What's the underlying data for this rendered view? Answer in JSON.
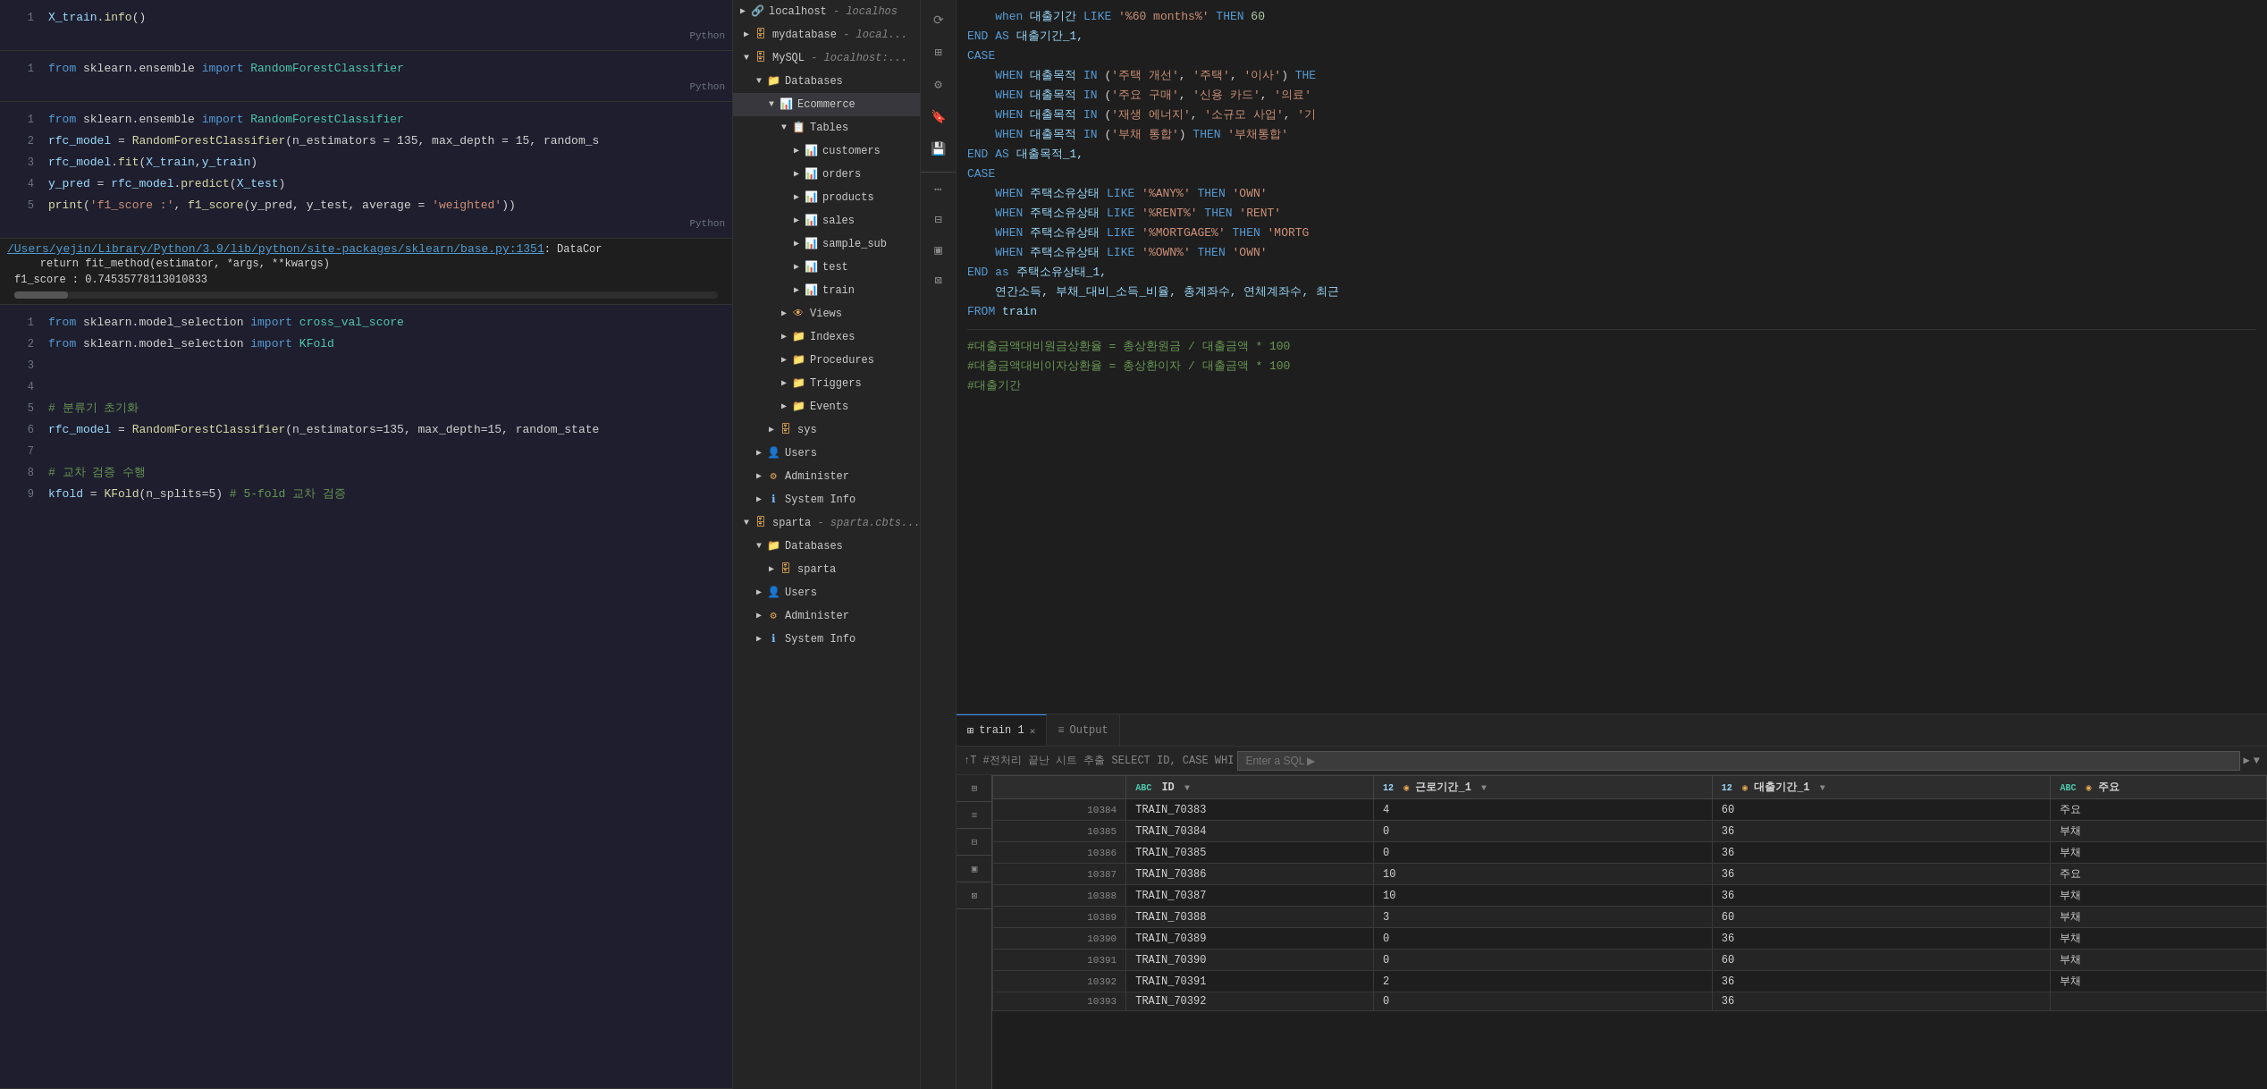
{
  "leftPanel": {
    "blocks": [
      {
        "id": "block1",
        "lines": [
          {
            "num": 1,
            "tokens": [
              {
                "t": "X_train",
                "c": "var"
              },
              {
                "t": ".",
                "c": "op"
              },
              {
                "t": "info",
                "c": "fn"
              },
              {
                "t": "()",
                "c": "op"
              }
            ]
          }
        ],
        "lang": "Python"
      },
      {
        "id": "block2",
        "lines": [
          {
            "num": 1,
            "tokens": [
              {
                "t": "from ",
                "c": "kw"
              },
              {
                "t": "sklearn.ensemble ",
                "c": "ident"
              },
              {
                "t": "import ",
                "c": "kw"
              },
              {
                "t": "RandomForestClassifier",
                "c": "cls"
              }
            ]
          }
        ],
        "lang": "Python"
      },
      {
        "id": "block3",
        "lines": [
          {
            "num": 1,
            "tokens": [
              {
                "t": "from ",
                "c": "kw"
              },
              {
                "t": "sklearn.ensemble ",
                "c": "ident"
              },
              {
                "t": "import ",
                "c": "kw"
              },
              {
                "t": "RandomForestClassifier",
                "c": "cls"
              }
            ]
          },
          {
            "num": 2,
            "tokens": [
              {
                "t": "rfc_model ",
                "c": "var"
              },
              {
                "t": "= ",
                "c": "op"
              },
              {
                "t": "RandomForestClassifier",
                "c": "fn"
              },
              {
                "t": "(n_estimators = 135, max_depth = 15, random_s",
                "c": "ident"
              }
            ]
          },
          {
            "num": 3,
            "tokens": [
              {
                "t": "rfc_model",
                "c": "var"
              },
              {
                "t": ".",
                "c": "op"
              },
              {
                "t": "fit",
                "c": "fn"
              },
              {
                "t": "(",
                "c": "op"
              },
              {
                "t": "X_train",
                "c": "var"
              },
              {
                "t": ",",
                "c": "op"
              },
              {
                "t": "y_train",
                "c": "var"
              },
              {
                "t": ")",
                "c": "op"
              }
            ]
          },
          {
            "num": 4,
            "tokens": [
              {
                "t": "y_pred ",
                "c": "var"
              },
              {
                "t": "= ",
                "c": "op"
              },
              {
                "t": "rfc_model",
                "c": "var"
              },
              {
                "t": ".",
                "c": "op"
              },
              {
                "t": "predict",
                "c": "fn"
              },
              {
                "t": "(",
                "c": "op"
              },
              {
                "t": "X_test",
                "c": "var"
              },
              {
                "t": ")",
                "c": "op"
              }
            ]
          },
          {
            "num": 5,
            "tokens": [
              {
                "t": "print",
                "c": "fn"
              },
              {
                "t": "(",
                "c": "op"
              },
              {
                "t": "'f1_score :'",
                "c": "str"
              },
              {
                "t": ", ",
                "c": "op"
              },
              {
                "t": "f1_score",
                "c": "fn"
              },
              {
                "t": "(y_pred, y_test, average = ",
                "c": "ident"
              },
              {
                "t": "'weighted'",
                "c": "str"
              },
              {
                "t": "))",
                "c": "op"
              }
            ]
          }
        ],
        "lang": "Python"
      }
    ],
    "errorLine": "/Users/yejin/Library/Python/3.9/lib/python/site-packages/sklearn/base.py:1351",
    "errorSuffix": ": DataCor",
    "returnLine": "    return fit_method(estimator, *args, **kwargs)",
    "f1Line": "f1_score : 0.74535778113010833",
    "block4": {
      "lines": [
        {
          "num": 1,
          "tokens": [
            {
              "t": "from ",
              "c": "kw"
            },
            {
              "t": "sklearn.model_selection ",
              "c": "ident"
            },
            {
              "t": "import ",
              "c": "kw"
            },
            {
              "t": "cross_val_score",
              "c": "cls"
            }
          ]
        },
        {
          "num": 2,
          "tokens": [
            {
              "t": "from ",
              "c": "kw"
            },
            {
              "t": "sklearn.model_selection ",
              "c": "ident"
            },
            {
              "t": "import ",
              "c": "kw"
            },
            {
              "t": "KFold",
              "c": "cls"
            }
          ]
        },
        {
          "num": 3,
          "tokens": []
        },
        {
          "num": 4,
          "tokens": []
        },
        {
          "num": 5,
          "tokens": [
            {
              "t": "# 분류기 초기화",
              "c": "cm"
            }
          ]
        },
        {
          "num": 6,
          "tokens": [
            {
              "t": "rfc_model ",
              "c": "var"
            },
            {
              "t": "= ",
              "c": "op"
            },
            {
              "t": "RandomForestClassifier",
              "c": "fn"
            },
            {
              "t": "(n_estimators=135, max_depth=15, random_state",
              "c": "ident"
            }
          ]
        },
        {
          "num": 7,
          "tokens": []
        },
        {
          "num": 8,
          "tokens": [
            {
              "t": "# 교차 검증 수행",
              "c": "cm"
            }
          ]
        },
        {
          "num": 9,
          "tokens": [
            {
              "t": "kfold ",
              "c": "var"
            },
            {
              "t": "= ",
              "c": "op"
            },
            {
              "t": "KFold",
              "c": "fn"
            },
            {
              "t": "(n_splits=5)  ",
              "c": "ident"
            },
            {
              "t": "# 5-fold 교차 검증",
              "c": "cm"
            }
          ]
        }
      ],
      "lang": "Python"
    }
  },
  "tree": {
    "items": [
      {
        "indent": 0,
        "arrow": "▶",
        "icon": "🔗",
        "label": "localhost",
        "italic": " - localhos",
        "id": "localhost"
      },
      {
        "indent": 1,
        "arrow": "▶",
        "icon": "🗄",
        "label": "mydatabase",
        "italic": " - local...",
        "id": "mydatabase"
      },
      {
        "indent": 1,
        "arrow": "▼",
        "icon": "🗄",
        "label": "MySQL",
        "italic": " - localhost:...",
        "id": "mysql"
      },
      {
        "indent": 2,
        "arrow": "▼",
        "icon": "📁",
        "label": "Databases",
        "italic": "",
        "id": "databases"
      },
      {
        "indent": 3,
        "arrow": "▼",
        "icon": "🗄",
        "label": "Ecommerce",
        "italic": "",
        "id": "ecommerce",
        "highlight": true
      },
      {
        "indent": 4,
        "arrow": "▼",
        "icon": "📋",
        "label": "Tables",
        "italic": "",
        "id": "tables"
      },
      {
        "indent": 5,
        "arrow": "▶",
        "icon": "📊",
        "label": "customers",
        "italic": "",
        "id": "customers"
      },
      {
        "indent": 5,
        "arrow": "▶",
        "icon": "📊",
        "label": "orders",
        "italic": "",
        "id": "orders"
      },
      {
        "indent": 5,
        "arrow": "▶",
        "icon": "📊",
        "label": "products",
        "italic": "",
        "id": "products"
      },
      {
        "indent": 5,
        "arrow": "▶",
        "icon": "📊",
        "label": "sales",
        "italic": "",
        "id": "sales"
      },
      {
        "indent": 5,
        "arrow": "▶",
        "icon": "📊",
        "label": "sample_sub",
        "italic": "",
        "id": "sample_sub"
      },
      {
        "indent": 5,
        "arrow": "▶",
        "icon": "📊",
        "label": "test",
        "italic": "",
        "id": "test"
      },
      {
        "indent": 5,
        "arrow": "▶",
        "icon": "📊",
        "label": "train",
        "italic": "",
        "id": "train"
      },
      {
        "indent": 4,
        "arrow": "▶",
        "icon": "👁",
        "label": "Views",
        "italic": "",
        "id": "views"
      },
      {
        "indent": 4,
        "arrow": "▶",
        "icon": "📁",
        "label": "Indexes",
        "italic": "",
        "id": "indexes"
      },
      {
        "indent": 4,
        "arrow": "▶",
        "icon": "📁",
        "label": "Procedures",
        "italic": "",
        "id": "procedures"
      },
      {
        "indent": 4,
        "arrow": "▶",
        "icon": "📁",
        "label": "Triggers",
        "italic": "",
        "id": "triggers"
      },
      {
        "indent": 4,
        "arrow": "▶",
        "icon": "📁",
        "label": "Events",
        "italic": "",
        "id": "events"
      },
      {
        "indent": 3,
        "arrow": "▶",
        "icon": "🗄",
        "label": "sys",
        "italic": "",
        "id": "sys"
      },
      {
        "indent": 2,
        "arrow": "▶",
        "icon": "👤",
        "label": "Users",
        "italic": "",
        "id": "mysql-users"
      },
      {
        "indent": 2,
        "arrow": "▶",
        "icon": "⚙",
        "label": "Administer",
        "italic": "",
        "id": "mysql-administer"
      },
      {
        "indent": 2,
        "arrow": "▶",
        "icon": "ℹ",
        "label": "System Info",
        "italic": "",
        "id": "mysql-sysinfo"
      },
      {
        "indent": 1,
        "arrow": "▼",
        "icon": "🗄",
        "label": "sparta",
        "italic": " - sparta.cbts...",
        "id": "sparta"
      },
      {
        "indent": 2,
        "arrow": "▼",
        "icon": "📁",
        "label": "Databases",
        "italic": "",
        "id": "sparta-databases"
      },
      {
        "indent": 3,
        "arrow": "▶",
        "icon": "🗄",
        "label": "sparta",
        "italic": "",
        "id": "sparta-db"
      },
      {
        "indent": 2,
        "arrow": "▶",
        "icon": "👤",
        "label": "Users",
        "italic": "",
        "id": "sparta-users"
      },
      {
        "indent": 2,
        "arrow": "▶",
        "icon": "⚙",
        "label": "Administer",
        "italic": "",
        "id": "sparta-admin"
      },
      {
        "indent": 2,
        "arrow": "▶",
        "icon": "ℹ",
        "label": "System Info",
        "italic": "",
        "id": "sparta-sysinfo"
      }
    ]
  },
  "iconStrip": {
    "icons": [
      {
        "id": "refresh-icon",
        "glyph": "⟳"
      },
      {
        "id": "grid-icon",
        "glyph": "⊞"
      },
      {
        "id": "settings-icon",
        "glyph": "⚙"
      },
      {
        "id": "bookmark-icon",
        "glyph": "🔖"
      },
      {
        "id": "save-icon",
        "glyph": "💾"
      }
    ]
  },
  "sqlEditor": {
    "lines": [
      "    when 대출기간 LIKE '%60 months%' THEN 60",
      "END AS 대출기간_1,",
      "CASE",
      "    WHEN 대출목적 IN ('주택 개선', '주택', '이사') THE",
      "    WHEN 대출목적 IN ('주요 구매', '신용 카드', '의료'",
      "    WHEN 대출목적 IN ('재생 에너지', '소규모 사업', '기",
      "    WHEN 대출목적 IN ('부채 통합') THEN '부채통합'",
      "END AS 대출목적_1,",
      "CASE",
      "    WHEN 주택소유상태 LIKE '%ANY%' THEN 'OWN'",
      "    WHEN 주택소유상태 LIKE '%RENT%' THEN 'RENT'",
      "    WHEN 주택소유상태 LIKE '%MORTGAGE%' THEN 'MORTG",
      "    WHEN 주택소유상태 LIKE '%OWN%' THEN 'OWN'",
      "END as 주택소유상태_1,",
      "    연간소득, 부채_대비_소득_비율, 총계좌수, 연체계좌수, 최근",
      "FROM train"
    ],
    "comments": [
      "#대출금액대비원금상환율 = 총상환원금 / 대출금액 * 100",
      "#대출금액대비이자상환율 = 총상환이자 / 대출금액 * 100",
      "#대출기간"
    ]
  },
  "bottomPanel": {
    "tabs": [
      {
        "id": "tab-train",
        "label": "train 1",
        "icon": "⊞",
        "active": true,
        "closeable": true
      },
      {
        "id": "tab-output",
        "label": "Output",
        "icon": "≡",
        "active": false,
        "closeable": false
      }
    ],
    "toolbar": {
      "sqlText": "↑T #전처리 끝난 시트 추출 SELECT ID, CASE WHI",
      "inputPlaceholder": "Enter a SQL ▶",
      "arrow": "▶",
      "dropdownArrow": "▼"
    },
    "table": {
      "columns": [
        {
          "id": "col-id",
          "typeLabel": "ABC",
          "typeClass": "str",
          "label": "ID",
          "sortIcon": "▼"
        },
        {
          "id": "col-근로기간",
          "typeLabel": "12",
          "typeClass": "num",
          "label": "근로기간_1",
          "sortIcon": "▼"
        },
        {
          "id": "col-대출기간",
          "typeLabel": "12",
          "typeClass": "num",
          "label": "대출기간_1",
          "sortIcon": "▼"
        },
        {
          "id": "col-extra",
          "typeLabel": "ABC",
          "typeClass": "str",
          "label": "주요",
          "sortIcon": ""
        }
      ],
      "rows": [
        {
          "rowNum": "10384",
          "id": "TRAIN_70383",
          "근로기간": "4",
          "대출기간": "60",
          "extra": "주요"
        },
        {
          "rowNum": "10385",
          "id": "TRAIN_70384",
          "근로기간": "0",
          "대출기간": "36",
          "extra": "부채"
        },
        {
          "rowNum": "10386",
          "id": "TRAIN_70385",
          "근로기간": "0",
          "대출기간": "36",
          "extra": "부채"
        },
        {
          "rowNum": "10387",
          "id": "TRAIN_70386",
          "근로기간": "10",
          "대출기간": "36",
          "extra": "주요"
        },
        {
          "rowNum": "10388",
          "id": "TRAIN_70387",
          "근로기간": "10",
          "대출기간": "36",
          "extra": "부채"
        },
        {
          "rowNum": "10389",
          "id": "TRAIN_70388",
          "근로기간": "3",
          "대출기간": "60",
          "extra": "부채"
        },
        {
          "rowNum": "10390",
          "id": "TRAIN_70389",
          "근로기간": "0",
          "대출기간": "36",
          "extra": "부채"
        },
        {
          "rowNum": "10391",
          "id": "TRAIN_70390",
          "근로기간": "0",
          "대출기간": "60",
          "extra": "부채"
        },
        {
          "rowNum": "10392",
          "id": "TRAIN_70391",
          "근로기간": "2",
          "대출기간": "36",
          "extra": "부채"
        },
        {
          "rowNum": "10393",
          "id": "TRAIN_70392",
          "근로기간": "0",
          "대출기간": "36",
          "extra": ""
        }
      ]
    },
    "sideLabels": [
      "⊞",
      "≡",
      "⊟",
      "▣",
      "⊠"
    ]
  }
}
